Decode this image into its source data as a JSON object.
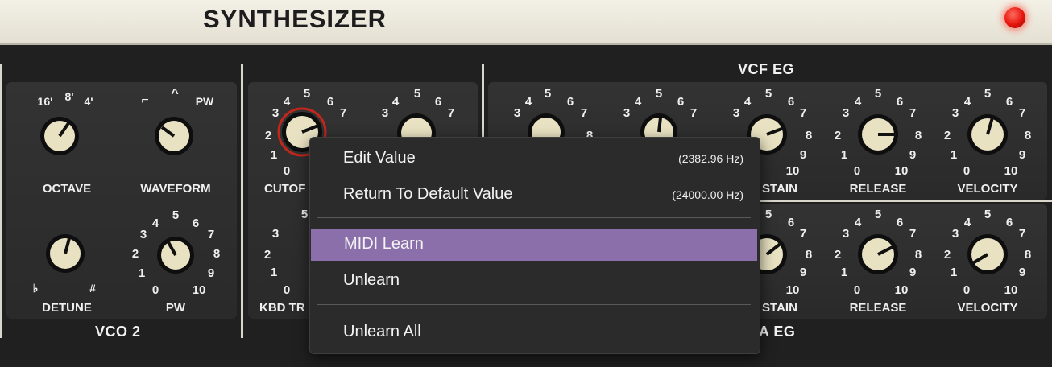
{
  "app": {
    "title": "SYNTHESIZER"
  },
  "sections": {
    "vco2": "VCO 2",
    "vcf_eg": "VCF EG",
    "vca_eg": "A EG"
  },
  "knob_labels": {
    "octave": "OCTAVE",
    "waveform": "WAVEFORM",
    "detune": "DETUNE",
    "pw": "PW",
    "cutoff": "CUTOF",
    "kbd_track": "KBD TR",
    "vcf_sustain": "STAIN",
    "vcf_release": "RELEASE",
    "vcf_velocity": "VELOCITY",
    "vca_sustain": "STAIN",
    "vca_release": "RELEASE",
    "vca_velocity": "VELOCITY"
  },
  "scale_marks": {
    "octave": [
      "16'",
      "8'",
      "4'"
    ],
    "waveform_pw": "PW",
    "detune_flat": "♭",
    "detune_sharp": "#",
    "dial": [
      "0",
      "1",
      "2",
      "3",
      "4",
      "5",
      "6",
      "7",
      "8",
      "9",
      "10"
    ]
  },
  "context_menu": {
    "items": [
      {
        "label": "Edit Value",
        "value": "(2382.96 Hz)"
      },
      {
        "label": "Return To Default Value",
        "value": "(24000.00 Hz)"
      },
      {
        "label": "MIDI Learn",
        "value": ""
      },
      {
        "label": "Unlearn",
        "value": ""
      },
      {
        "label": "Unlearn All",
        "value": ""
      }
    ],
    "highlighted": "MIDI Learn"
  },
  "colors": {
    "menu_highlight": "#8b6fab",
    "led": "#e5140c",
    "cutoff_ring": "#c2261c"
  }
}
